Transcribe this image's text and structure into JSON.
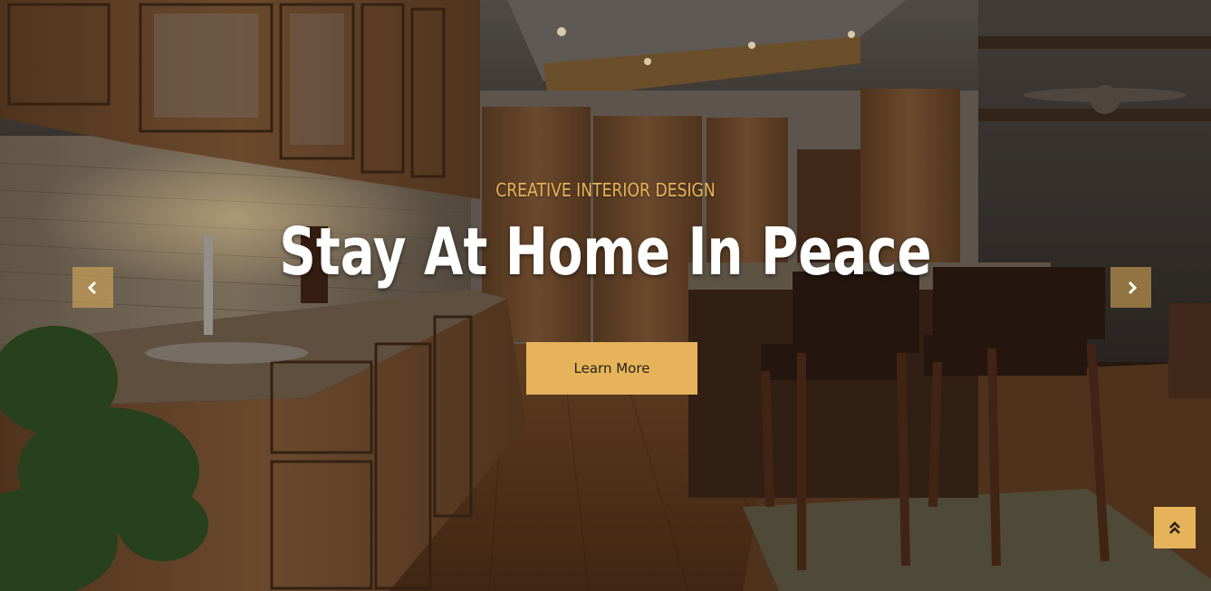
{
  "slider": {
    "subtitle": "CREATIVE INTERIOR DESIGN",
    "title": "Stay At Home In Peace",
    "cta_label": "Learn More"
  },
  "icons": {
    "prev": "chevron-left-icon",
    "next": "chevron-right-icon",
    "back_to_top": "double-chevron-up-icon"
  },
  "colors": {
    "accent": "#e6b35b",
    "title": "#ffffff",
    "subtitle": "#e7b35a"
  }
}
